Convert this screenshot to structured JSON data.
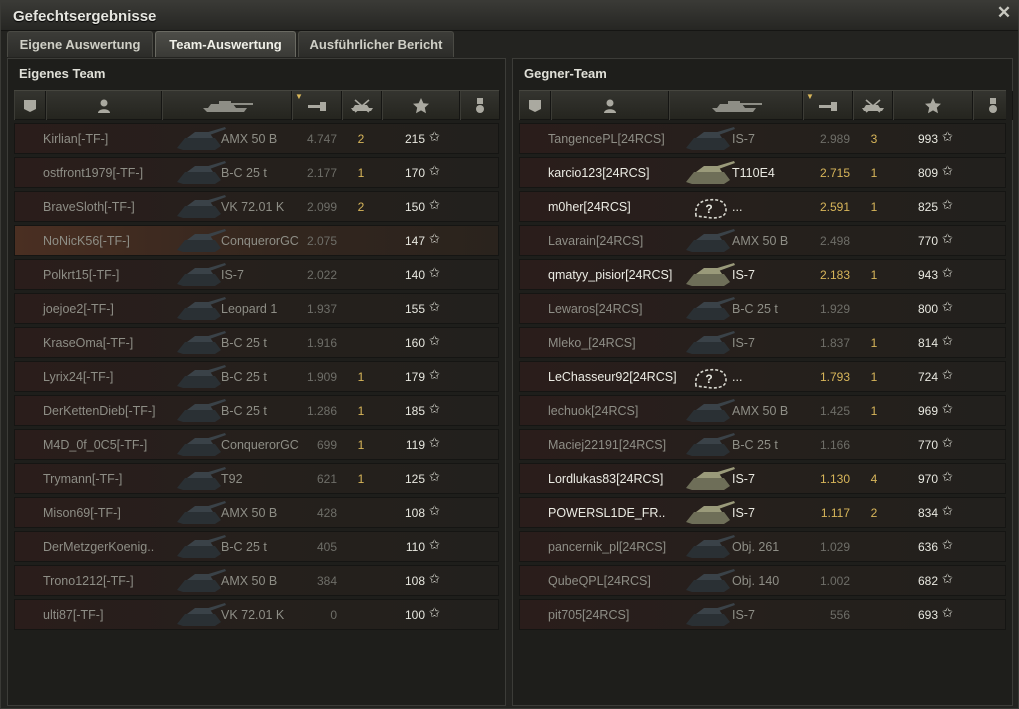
{
  "window": {
    "title": "Gefechtsergebnisse",
    "close_icon": "close-icon"
  },
  "tabs": [
    {
      "label": "Eigene Auswertung",
      "active": false
    },
    {
      "label": "Team-Auswertung",
      "active": true
    },
    {
      "label": "Ausführlicher Bericht",
      "active": false
    }
  ],
  "own_team": {
    "title": "Eigenes Team",
    "columns": [
      "platoon-icon",
      "player-icon",
      "tank-icon",
      "damage-icon",
      "kills-icon",
      "xp-star-icon",
      "medal-icon"
    ],
    "rows": [
      {
        "player": "Kirlian[-TF-]",
        "tank": "AMX 50 B",
        "damage": "4.747",
        "kills": "2",
        "xp": "215"
      },
      {
        "player": "ostfront1979[-TF-]",
        "tank": "B-C 25 t",
        "damage": "2.177",
        "kills": "1",
        "xp": "170"
      },
      {
        "player": "BraveSloth[-TF-]",
        "tank": "VK 72.01 K",
        "damage": "2.099",
        "kills": "2",
        "xp": "150"
      },
      {
        "player": "NoNicK56[-TF-]",
        "tank": "ConquerorGC",
        "damage": "2.075",
        "kills": "",
        "xp": "147",
        "highlight": true
      },
      {
        "player": "Polkrt15[-TF-]",
        "tank": "IS-7",
        "damage": "2.022",
        "kills": "",
        "xp": "140"
      },
      {
        "player": "joejoe2[-TF-]",
        "tank": "Leopard 1",
        "damage": "1.937",
        "kills": "",
        "xp": "155"
      },
      {
        "player": "KraseOma[-TF-]",
        "tank": "B-C 25 t",
        "damage": "1.916",
        "kills": "",
        "xp": "160"
      },
      {
        "player": "Lyrix24[-TF-]",
        "tank": "B-C 25 t",
        "damage": "1.909",
        "kills": "1",
        "xp": "179"
      },
      {
        "player": "DerKettenDieb[-TF-]",
        "tank": "B-C 25 t",
        "damage": "1.286",
        "kills": "1",
        "xp": "185"
      },
      {
        "player": "M4D_0f_0C5[-TF-]",
        "tank": "ConquerorGC",
        "damage": "699",
        "kills": "1",
        "xp": "119"
      },
      {
        "player": "Trymann[-TF-]",
        "tank": "T92",
        "damage": "621",
        "kills": "1",
        "xp": "125"
      },
      {
        "player": "Mison69[-TF-]",
        "tank": "AMX 50 B",
        "damage": "428",
        "kills": "",
        "xp": "108"
      },
      {
        "player": "DerMetzgerKoenig..",
        "tank": "B-C 25 t",
        "damage": "405",
        "kills": "",
        "xp": "110"
      },
      {
        "player": "Trono1212[-TF-]",
        "tank": "AMX 50 B",
        "damage": "384",
        "kills": "",
        "xp": "108"
      },
      {
        "player": "ulti87[-TF-]",
        "tank": "VK 72.01 K",
        "damage": "0",
        "kills": "",
        "xp": "100"
      }
    ]
  },
  "enemy_team": {
    "title": "Gegner-Team",
    "columns": [
      "platoon-icon",
      "player-icon",
      "tank-icon",
      "damage-icon",
      "kills-icon",
      "xp-star-icon",
      "medal-icon"
    ],
    "rows": [
      {
        "player": "TangencePL[24RCS]",
        "tank": "IS-7",
        "damage": "2.989",
        "kills": "3",
        "xp": "993",
        "alive": false
      },
      {
        "player": "karcio123[24RCS]",
        "tank": "T110E4",
        "damage": "2.715",
        "kills": "1",
        "xp": "809",
        "alive": true
      },
      {
        "player": "m0her[24RCS]",
        "tank": "...",
        "damage": "2.591",
        "kills": "1",
        "xp": "825",
        "alive": true,
        "unknown": true
      },
      {
        "player": "Lavarain[24RCS]",
        "tank": "AMX 50 B",
        "damage": "2.498",
        "kills": "",
        "xp": "770",
        "alive": false
      },
      {
        "player": "qmatyy_pisior[24RCS]",
        "tank": "IS-7",
        "damage": "2.183",
        "kills": "1",
        "xp": "943",
        "alive": true
      },
      {
        "player": "Lewaros[24RCS]",
        "tank": "B-C 25 t",
        "damage": "1.929",
        "kills": "",
        "xp": "800",
        "alive": false
      },
      {
        "player": "Mleko_[24RCS]",
        "tank": "IS-7",
        "damage": "1.837",
        "kills": "1",
        "xp": "814",
        "alive": false
      },
      {
        "player": "LeChasseur92[24RCS]",
        "tank": "...",
        "damage": "1.793",
        "kills": "1",
        "xp": "724",
        "alive": true,
        "unknown": true
      },
      {
        "player": "lechuok[24RCS]",
        "tank": "AMX 50 B",
        "damage": "1.425",
        "kills": "1",
        "xp": "969",
        "alive": false
      },
      {
        "player": "Maciej22191[24RCS]",
        "tank": "B-C 25 t",
        "damage": "1.166",
        "kills": "",
        "xp": "770",
        "alive": false
      },
      {
        "player": "Lordlukas83[24RCS]",
        "tank": "IS-7",
        "damage": "1.130",
        "kills": "4",
        "xp": "970",
        "alive": true
      },
      {
        "player": "POWERSL1DE_FR..",
        "tank": "IS-7",
        "damage": "1.117",
        "kills": "2",
        "xp": "834",
        "alive": true
      },
      {
        "player": "pancernik_pl[24RCS]",
        "tank": "Obj. 261",
        "damage": "1.029",
        "kills": "",
        "xp": "636",
        "alive": false
      },
      {
        "player": "QubeQPL[24RCS]",
        "tank": "Obj. 140",
        "damage": "1.002",
        "kills": "",
        "xp": "682",
        "alive": false
      },
      {
        "player": "pit705[24RCS]",
        "tank": "IS-7",
        "damage": "556",
        "kills": "",
        "xp": "693",
        "alive": false
      }
    ]
  },
  "star_glyph": "✩",
  "unknown_glyph": "?"
}
